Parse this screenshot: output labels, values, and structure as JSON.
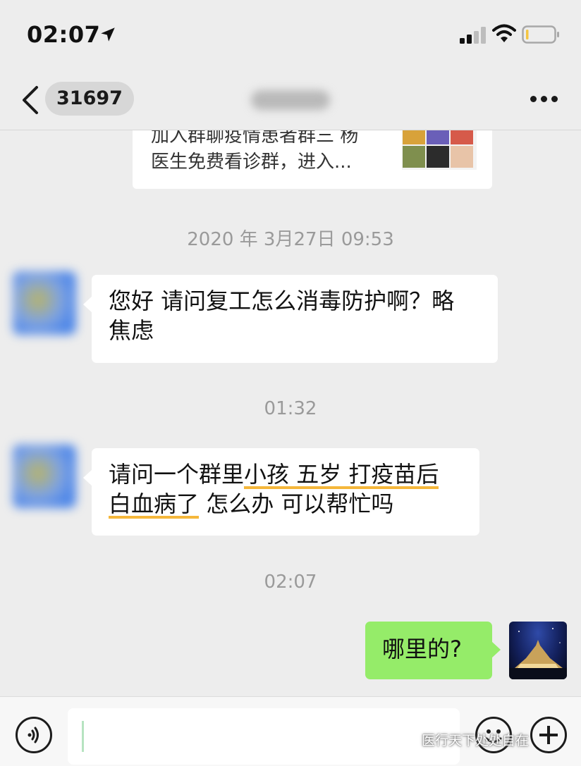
{
  "status_bar": {
    "time": "02:07",
    "location_icon": "location-arrow-icon",
    "signal_icon": "cellular-signal-icon",
    "wifi_icon": "wifi-icon",
    "battery_icon": "battery-low-icon"
  },
  "nav": {
    "back_icon": "chevron-left-icon",
    "unread_count": "31697",
    "more_icon": "more-dots-icon"
  },
  "link_card": {
    "desc_line1": "加入群聊疫情患者群三 杨",
    "desc_line2": "医生免费看诊群，进入..."
  },
  "messages": [
    {
      "type": "timestamp",
      "text": "2020 年 3月27日 09:53"
    },
    {
      "type": "incoming",
      "lines": [
        "您好 请问复工怎么消毒防护啊？略",
        "焦虑"
      ]
    },
    {
      "type": "timestamp",
      "text": "01:32"
    },
    {
      "type": "incoming",
      "line1_a": "请问一个群里",
      "line1_b": "小孩 五岁 打疫苗后",
      "line2_a": "白血病了",
      "line2_b": " 怎么办 可以帮忙吗"
    },
    {
      "type": "timestamp",
      "text": "02:07"
    },
    {
      "type": "outgoing",
      "text": "哪里的?"
    }
  ],
  "input_bar": {
    "voice_icon": "voice-icon",
    "emoji_icon": "emoji-icon",
    "plus_icon": "plus-icon"
  },
  "colors": {
    "background": "#ededed",
    "outgoing_bubble": "#95ec69",
    "incoming_bubble": "#ffffff",
    "highlight_underline": "#f5b73b"
  },
  "watermark": "医行天下处处自在"
}
